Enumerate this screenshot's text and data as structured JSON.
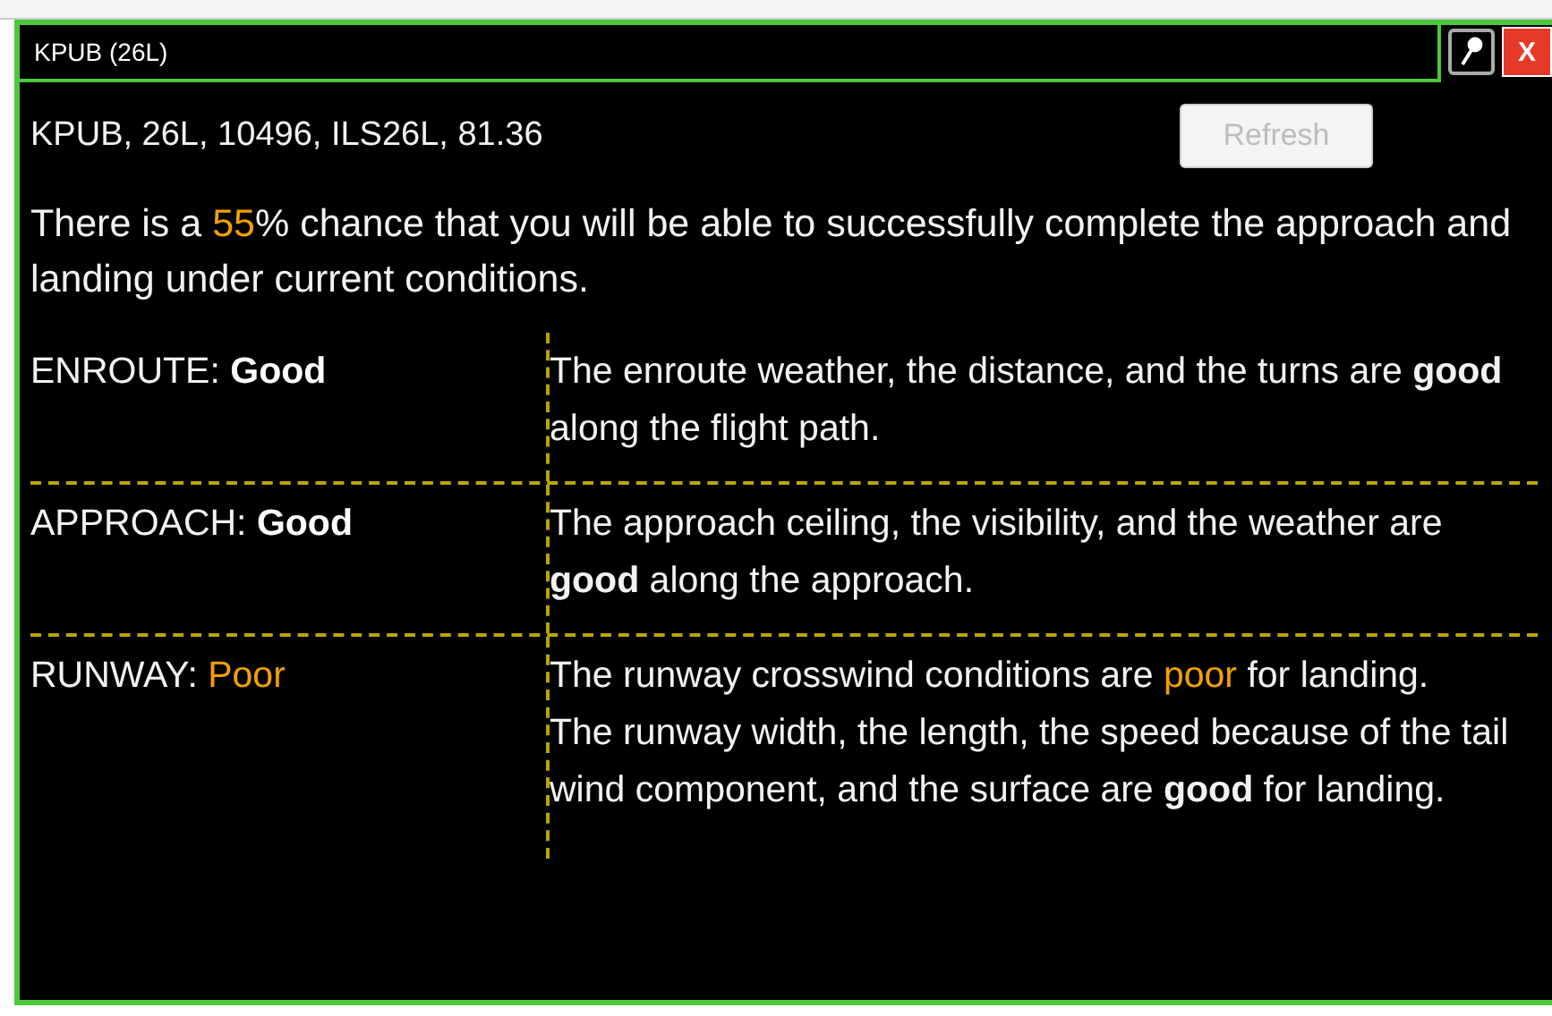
{
  "window": {
    "title": "KPUB (26L)",
    "pinned": false
  },
  "info_line": "KPUB, 26L, 10496, ILS26L, 81.36",
  "refresh_button": {
    "label": "Refresh",
    "disabled": true
  },
  "close_button": {
    "label": "X"
  },
  "summary": [
    {
      "text": "There is a ",
      "warning": false
    },
    {
      "text": "55",
      "warning": true
    },
    {
      "text": "% chance that you will be able to successfully complete the approach and landing under current conditions.",
      "warning": false
    }
  ],
  "factors": [
    {
      "label": "ENROUTE: ",
      "rating": "Good",
      "warning": false,
      "paragraphs": [
        [
          {
            "text": "The enroute weather, the distance, and the turns are **good** along the flight path.",
            "warning": false
          }
        ]
      ]
    },
    {
      "label": "APPROACH: ",
      "rating": "Good",
      "warning": false,
      "paragraphs": [
        [
          {
            "text": "The approach ceiling, the visibility, and the weather are **good** along the approach.",
            "warning": false
          }
        ]
      ]
    },
    {
      "label": "RUNWAY: ",
      "rating": "Poor",
      "warning": true,
      "paragraphs": [
        [
          {
            "text": "The runway crosswind conditions are ",
            "warning": false
          },
          {
            "text": "poor",
            "warning": true
          },
          {
            "text": " for landing.",
            "warning": false
          }
        ],
        [
          {
            "text": "The runway width, the length, the speed because of the tail wind component, and the surface are **good** for landing.",
            "warning": false
          }
        ]
      ]
    }
  ]
}
